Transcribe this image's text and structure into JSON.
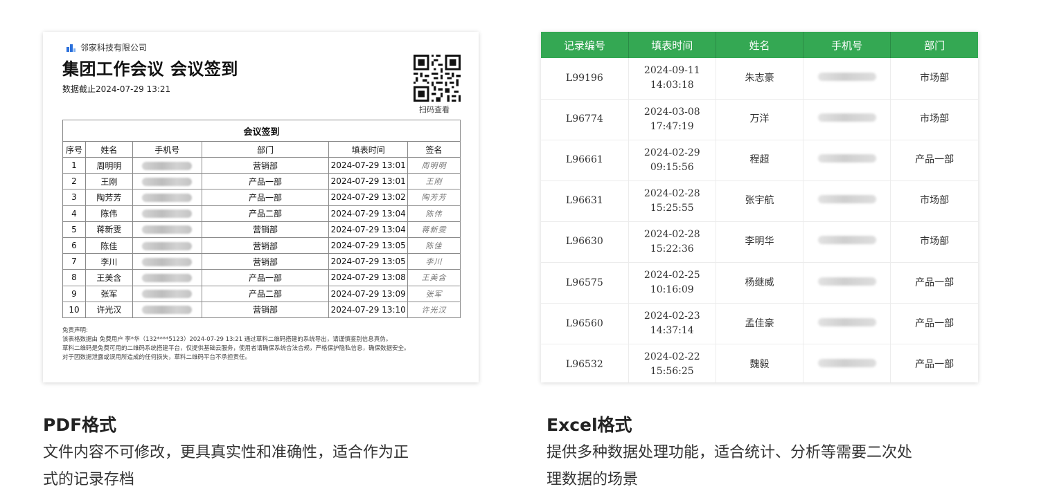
{
  "pdf": {
    "company": "邻家科技有限公司",
    "title": "集团工作会议 会议签到",
    "date_line": "数据截止2024-07-29 13:21",
    "qr_label": "扫码查看",
    "table_caption": "会议签到",
    "headers": [
      "序号",
      "姓名",
      "手机号",
      "部门",
      "填表时间",
      "签名"
    ],
    "rows": [
      {
        "no": "1",
        "name": "周明明",
        "dept": "营销部",
        "time": "2024-07-29 13:01",
        "sig": "周明明"
      },
      {
        "no": "2",
        "name": "王刚",
        "dept": "产品一部",
        "time": "2024-07-29 13:01",
        "sig": "王刚"
      },
      {
        "no": "3",
        "name": "陶芳芳",
        "dept": "产品一部",
        "time": "2024-07-29 13:02",
        "sig": "陶芳芳"
      },
      {
        "no": "4",
        "name": "陈伟",
        "dept": "产品二部",
        "time": "2024-07-29 13:04",
        "sig": "陈伟"
      },
      {
        "no": "5",
        "name": "蒋新雯",
        "dept": "营销部",
        "time": "2024-07-29 13:04",
        "sig": "蒋新雯"
      },
      {
        "no": "6",
        "name": "陈佳",
        "dept": "营销部",
        "time": "2024-07-29 13:05",
        "sig": "陈佳"
      },
      {
        "no": "7",
        "name": "李川",
        "dept": "营销部",
        "time": "2024-07-29 13:05",
        "sig": "李川"
      },
      {
        "no": "8",
        "name": "王美含",
        "dept": "产品一部",
        "time": "2024-07-29 13:08",
        "sig": "王美含"
      },
      {
        "no": "9",
        "name": "张军",
        "dept": "产品二部",
        "time": "2024-07-29 13:09",
        "sig": "张军"
      },
      {
        "no": "10",
        "name": "许光汉",
        "dept": "营销部",
        "time": "2024-07-29 13:10",
        "sig": "许光汉"
      }
    ],
    "disclaimer": [
      "免责声明:",
      "该表格数据由 免费用户 李*华（132****5123）2024-07-29 13:21 通过草料二维码搭建的系统导出，请谨慎鉴别信息真伪。",
      "草料二维码是免费可用的二维码系统搭建平台，仅提供基础云服务，使用者请确保系统合法合规，严格保护隐私信息，确保数据安全。",
      "对于因数据泄露或误用所造成的任何损失，草料二维码平台不承担责任。"
    ]
  },
  "excel": {
    "headers": [
      "记录编号",
      "填表时间",
      "姓名",
      "手机号",
      "部门"
    ],
    "rows": [
      {
        "id": "L99196",
        "date": "2024-09-11",
        "time": "14:03:18",
        "name": "朱志豪",
        "dept": "市场部"
      },
      {
        "id": "L96774",
        "date": "2024-03-08",
        "time": "17:47:19",
        "name": "万洋",
        "dept": "市场部"
      },
      {
        "id": "L96661",
        "date": "2024-02-29",
        "time": "09:15:56",
        "name": "程超",
        "dept": "产品一部"
      },
      {
        "id": "L96631",
        "date": "2024-02-28",
        "time": "15:25:55",
        "name": "张宇航",
        "dept": "市场部"
      },
      {
        "id": "L96630",
        "date": "2024-02-28",
        "time": "15:22:36",
        "name": "李明华",
        "dept": "市场部"
      },
      {
        "id": "L96575",
        "date": "2024-02-25",
        "time": "10:16:09",
        "name": "杨继威",
        "dept": "产品一部"
      },
      {
        "id": "L96560",
        "date": "2024-02-23",
        "time": "14:37:14",
        "name": "孟佳豪",
        "dept": "产品一部"
      },
      {
        "id": "L96532",
        "date": "2024-02-22",
        "time": "15:56:25",
        "name": "魏毅",
        "dept": "产品一部"
      }
    ]
  },
  "captions": {
    "pdf_title": "PDF格式",
    "pdf_desc_1": "文件内容不可修改，更具真实性和准确性，适合作为正",
    "pdf_desc_2": "式的记录存档",
    "excel_title": "Excel格式",
    "excel_desc_1": "提供多种数据处理功能，适合统计、分析等需要二次处",
    "excel_desc_2": "理数据的场景"
  },
  "colors": {
    "excel_header_green": "#34a853",
    "logo_blue": "#2a6fdb"
  },
  "icons": {
    "company_logo": "building-bars-icon",
    "qr": "qr-code-icon"
  }
}
